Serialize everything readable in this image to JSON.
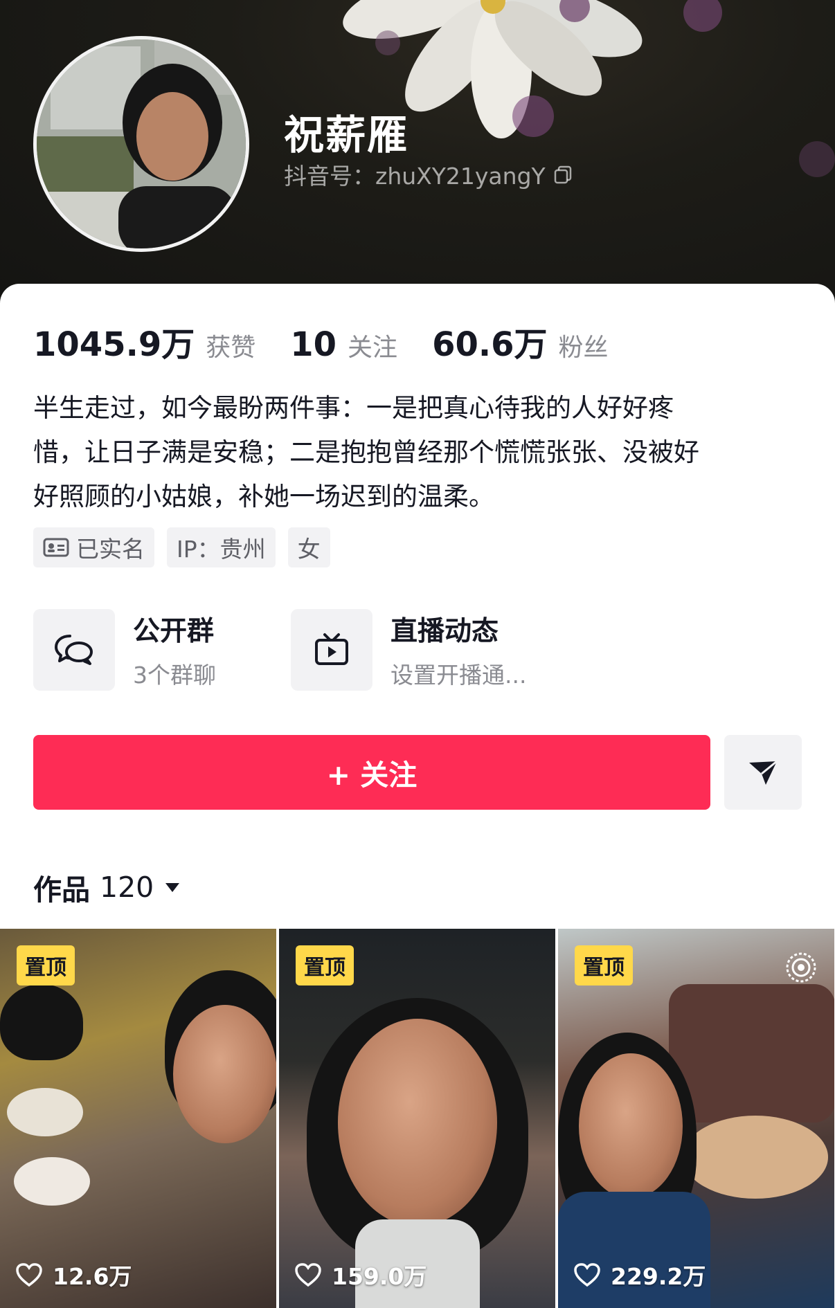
{
  "profile": {
    "name": "祝薪雁",
    "douyin_id": "抖音号：zhuXY21yangY"
  },
  "stats": [
    {
      "value": "1045.9万",
      "label": "获赞"
    },
    {
      "value": "10",
      "label": "关注"
    },
    {
      "value": "60.6万",
      "label": "粉丝"
    }
  ],
  "bio": {
    "lines": [
      "半生走过，如今最盼两件事：一是把真心待我的人好好疼",
      "惜，让日子满是安稳；二是抱抱曾经那个慌慌张张、没被好",
      "好照顾的小姑娘，补她一场迟到的温柔。"
    ]
  },
  "tags": {
    "verified": "已实名",
    "ip": "IP：贵州",
    "gender": "女"
  },
  "features": [
    {
      "title": "公开群",
      "subtitle": "3个群聊",
      "icon": "chat-bubble-icon"
    },
    {
      "title": "直播动态",
      "subtitle": "设置开播通...",
      "icon": "tv-icon"
    }
  ],
  "actions": {
    "follow_label": "+ 关注",
    "share_icon": "send-icon"
  },
  "works": {
    "label": "作品",
    "count": "120"
  },
  "videos": [
    {
      "pinned": "置顶",
      "likes": "12.6万"
    },
    {
      "pinned": "置顶",
      "likes": "159.0万"
    },
    {
      "pinned": "置顶",
      "likes": "229.2万",
      "live_icon": "live-icon"
    }
  ],
  "colors": {
    "accent": "#fe2c55",
    "pin_badge": "#ffd84a",
    "header_bg": "#1a1a16"
  }
}
